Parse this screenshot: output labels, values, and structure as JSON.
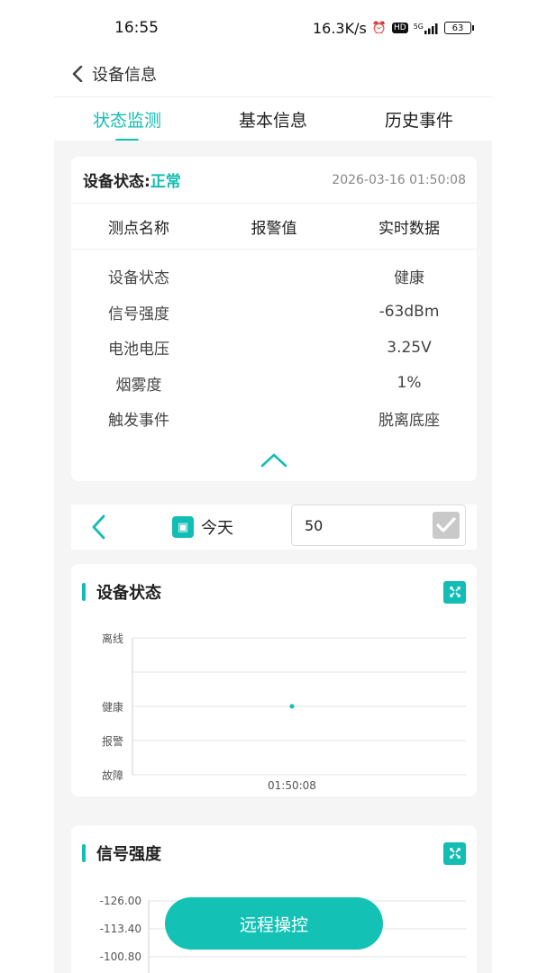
{
  "status_bar": {
    "time": "16:55",
    "net_speed": "16.3K/s",
    "hd": "HD",
    "signal": "5G",
    "battery": "63"
  },
  "header": {
    "title": "设备信息"
  },
  "tabs": [
    {
      "label": "状态监测",
      "active": true
    },
    {
      "label": "基本信息",
      "active": false
    },
    {
      "label": "历史事件",
      "active": false
    }
  ],
  "status_card": {
    "title_label": "设备状态:",
    "title_value": "正常",
    "timestamp": "2026-03-16 01:50:08",
    "columns": [
      "测点名称",
      "报警值",
      "实时数据"
    ],
    "rows": [
      {
        "name": "设备状态",
        "alarm": "",
        "value": "健康"
      },
      {
        "name": "信号强度",
        "alarm": "",
        "value": "-63dBm"
      },
      {
        "name": "电池电压",
        "alarm": "",
        "value": "3.25V"
      },
      {
        "name": "烟雾度",
        "alarm": "",
        "value": "1%"
      },
      {
        "name": "触发事件",
        "alarm": "",
        "value": "脱离底座"
      }
    ]
  },
  "date_bar": {
    "date_label": "今天",
    "count_value": "50"
  },
  "charts_meta": [
    {
      "title": "设备状态"
    },
    {
      "title": "信号强度"
    }
  ],
  "chart_data": [
    {
      "type": "scatter",
      "title": "设备状态",
      "y_categories": [
        "故障",
        "报警",
        "健康",
        "",
        "离线"
      ],
      "x": [
        "01:50:08"
      ],
      "points": [
        {
          "x": "01:50:08",
          "y": "健康"
        }
      ],
      "grid": true
    },
    {
      "type": "line",
      "title": "信号强度",
      "y_ticks": [
        -126.0,
        -113.4,
        -100.8
      ],
      "grid": true,
      "series": []
    }
  ],
  "remote_button": {
    "label": "远程操控"
  },
  "colors": {
    "accent": "#13bdb3",
    "button": "#13c2b5"
  }
}
